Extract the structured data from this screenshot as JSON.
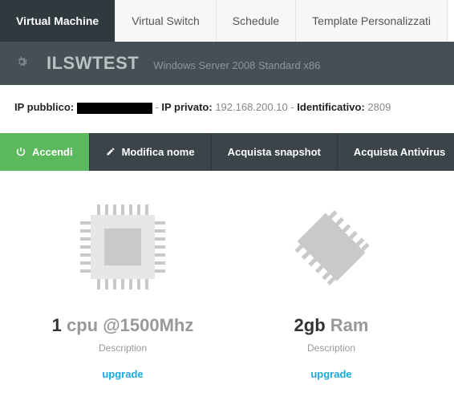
{
  "tabs": {
    "vm": "Virtual Machine",
    "vswitch": "Virtual Switch",
    "schedule": "Schedule",
    "templates": "Template Personalizzati"
  },
  "header": {
    "name": "ILSWTEST",
    "os": "Windows Server 2008 Standard x86"
  },
  "info": {
    "ip_pub_label": "IP pubblico:",
    "ip_pub_value": "",
    "ip_priv_label": "IP privato:",
    "ip_priv_value": "192.168.200.10",
    "id_label": "Identificativo:",
    "id_value": "2809",
    "sep": " - "
  },
  "actions": {
    "power": "Accendi",
    "rename": "Modifica nome",
    "snapshot": "Acquista snapshot",
    "antivirus": "Acquista Antivirus"
  },
  "cards": {
    "cpu": {
      "count": "1",
      "label": "cpu @1500Mhz",
      "desc": "Description",
      "link": "upgrade"
    },
    "ram": {
      "count": "2gb",
      "label": "Ram",
      "desc": "Description",
      "link": "upgrade"
    }
  }
}
